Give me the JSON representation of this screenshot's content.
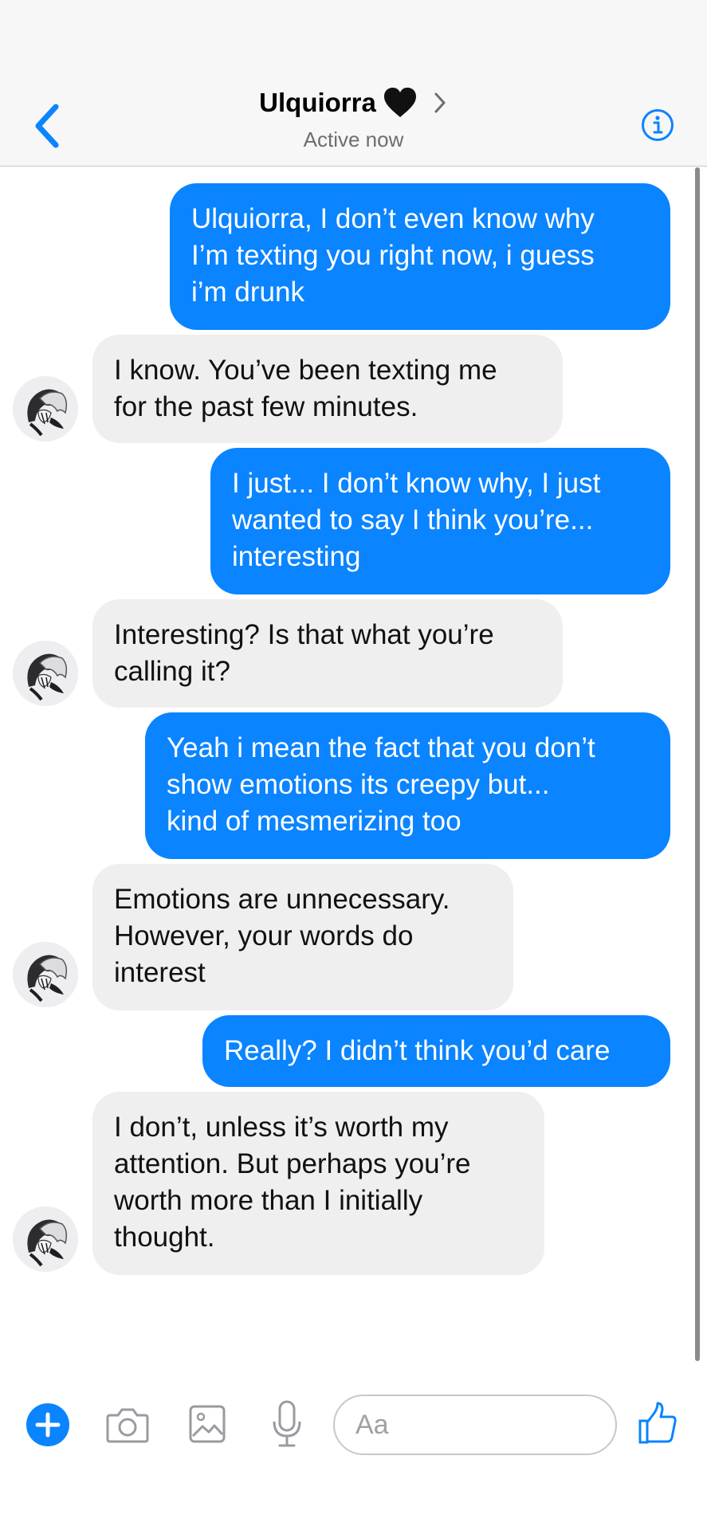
{
  "header": {
    "contact_name": "Ulquiorra",
    "status": "Active now"
  },
  "icons": {
    "back": "chevron-left-icon",
    "heart": "black-heart-icon",
    "chevron": "chevron-right-icon",
    "info": "info-icon",
    "plus": "plus-icon",
    "camera": "camera-icon",
    "gallery": "photo-icon",
    "mic": "microphone-icon",
    "like": "thumbs-up-icon"
  },
  "colors": {
    "accent": "#0a84ff",
    "incoming_bubble": "#efeff0",
    "header_bg": "#f7f7f8"
  },
  "messages": [
    {
      "direction": "out",
      "text": "Ulquiorra, I don’t even know why\nI’m texting you right now, i guess\ni’m drunk"
    },
    {
      "direction": "in",
      "text": "I know. You’ve been texting me\nfor the past few minutes."
    },
    {
      "direction": "out",
      "text": "I just... I don’t know why, I just\nwanted to say I think you’re...\ninteresting"
    },
    {
      "direction": "in",
      "text": "Interesting? Is that what you’re\ncalling it?"
    },
    {
      "direction": "out",
      "text": "Yeah i mean the fact that you don’t\nshow emotions its creepy but...\nkind of mesmerizing too"
    },
    {
      "direction": "in",
      "text": "Emotions are unnecessary.\nHowever, your words do\ninterest"
    },
    {
      "direction": "out",
      "text": "Really? I didn’t think you’d care"
    },
    {
      "direction": "in",
      "text": "I don’t, unless it’s worth my\nattention. But perhaps you’re\nworth more than I initially\nthought."
    }
  ],
  "composer": {
    "placeholder": "Aa"
  }
}
